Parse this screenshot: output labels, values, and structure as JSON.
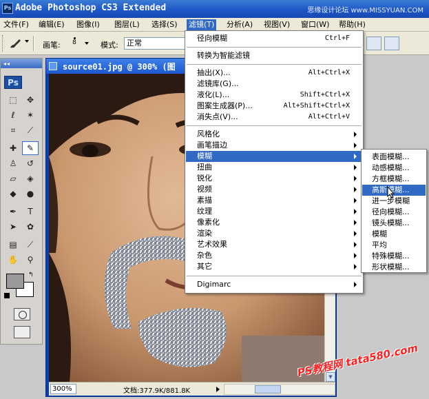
{
  "app": {
    "title": "Adobe Photoshop CS3 Extended",
    "site_mark": "思缘设计论坛 www.MISSYUAN.COM"
  },
  "menubar": [
    {
      "label": "文件(F)"
    },
    {
      "label": "编辑(E)"
    },
    {
      "label": "图像(I)"
    },
    {
      "label": "图层(L)"
    },
    {
      "label": "选择(S)"
    },
    {
      "label": "滤镜(T)",
      "active": true
    },
    {
      "label": "分析(A)"
    },
    {
      "label": "视图(V)"
    },
    {
      "label": "窗口(W)"
    },
    {
      "label": "帮助(H)"
    }
  ],
  "options_bar": {
    "brush_label": "画笔:",
    "brush_size": "8",
    "mode_label": "模式:",
    "mode_value": "正常"
  },
  "toolbox": {
    "logo": "Ps"
  },
  "document": {
    "title": "source01.jpg @ 300% (图",
    "zoom": "300%",
    "doc_info": "文档:377.9K/881.8K"
  },
  "filter_menu": {
    "items": [
      {
        "label": "径向模糊",
        "shortcut": "Ctrl+F"
      },
      {
        "label": "转换为智能滤镜"
      },
      {
        "label": "抽出(X)...",
        "shortcut": "Alt+Ctrl+X"
      },
      {
        "label": "滤镜库(G)..."
      },
      {
        "label": "液化(L)...",
        "shortcut": "Shift+Ctrl+X"
      },
      {
        "label": "图案生成器(P)...",
        "shortcut": "Alt+Shift+Ctrl+X"
      },
      {
        "label": "消失点(V)...",
        "shortcut": "Alt+Ctrl+V"
      },
      {
        "label": "风格化",
        "submenu": true
      },
      {
        "label": "画笔描边",
        "submenu": true
      },
      {
        "label": "模糊",
        "submenu": true,
        "highlighted": true
      },
      {
        "label": "扭曲",
        "submenu": true
      },
      {
        "label": "锐化",
        "submenu": true
      },
      {
        "label": "视频",
        "submenu": true
      },
      {
        "label": "素描",
        "submenu": true
      },
      {
        "label": "纹理",
        "submenu": true
      },
      {
        "label": "像素化",
        "submenu": true
      },
      {
        "label": "渲染",
        "submenu": true
      },
      {
        "label": "艺术效果",
        "submenu": true
      },
      {
        "label": "杂色",
        "submenu": true
      },
      {
        "label": "其它",
        "submenu": true
      },
      {
        "label": "Digimarc",
        "submenu": true
      }
    ]
  },
  "blur_submenu": {
    "items": [
      {
        "label": "表面模糊..."
      },
      {
        "label": "动感模糊..."
      },
      {
        "label": "方框模糊..."
      },
      {
        "label": "高斯模糊...",
        "highlighted": true
      },
      {
        "label": "进一步模糊"
      },
      {
        "label": "径向模糊..."
      },
      {
        "label": "镜头模糊..."
      },
      {
        "label": "模糊"
      },
      {
        "label": "平均"
      },
      {
        "label": "特殊模糊..."
      },
      {
        "label": "形状模糊..."
      }
    ]
  },
  "watermark": "PS教程网 tata580.com",
  "colors": {
    "title_bar": "#1c55c4",
    "menu_highlight": "#316ac5",
    "foreground_swatch": "#9a9a9a",
    "background_swatch": "#ffffff"
  }
}
